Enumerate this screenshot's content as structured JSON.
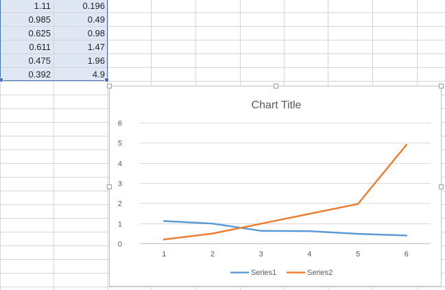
{
  "spreadsheet": {
    "rows": [
      [
        "1.11",
        "0.196"
      ],
      [
        "0.985",
        "0.49"
      ],
      [
        "0.625",
        "0.98"
      ],
      [
        "0.611",
        "1.47"
      ],
      [
        "0.475",
        "1.96"
      ],
      [
        "0.392",
        "4.9"
      ]
    ]
  },
  "chart_data": {
    "type": "line",
    "title": "Chart Title",
    "xlabel": "",
    "ylabel": "",
    "x": [
      1,
      2,
      3,
      4,
      5,
      6
    ],
    "categories": [
      "1",
      "2",
      "3",
      "4",
      "5",
      "6"
    ],
    "ylim": [
      0,
      6
    ],
    "yticks": [
      "0",
      "1",
      "2",
      "3",
      "4",
      "5",
      "6"
    ],
    "grid": true,
    "legend": "bottom",
    "series": [
      {
        "name": "Series1",
        "color": "#5b9bd5",
        "values": [
          1.11,
          0.985,
          0.625,
          0.611,
          0.475,
          0.392
        ]
      },
      {
        "name": "Series2",
        "color": "#ed7d31",
        "values": [
          0.196,
          0.49,
          0.98,
          1.47,
          1.96,
          4.9
        ]
      }
    ]
  }
}
